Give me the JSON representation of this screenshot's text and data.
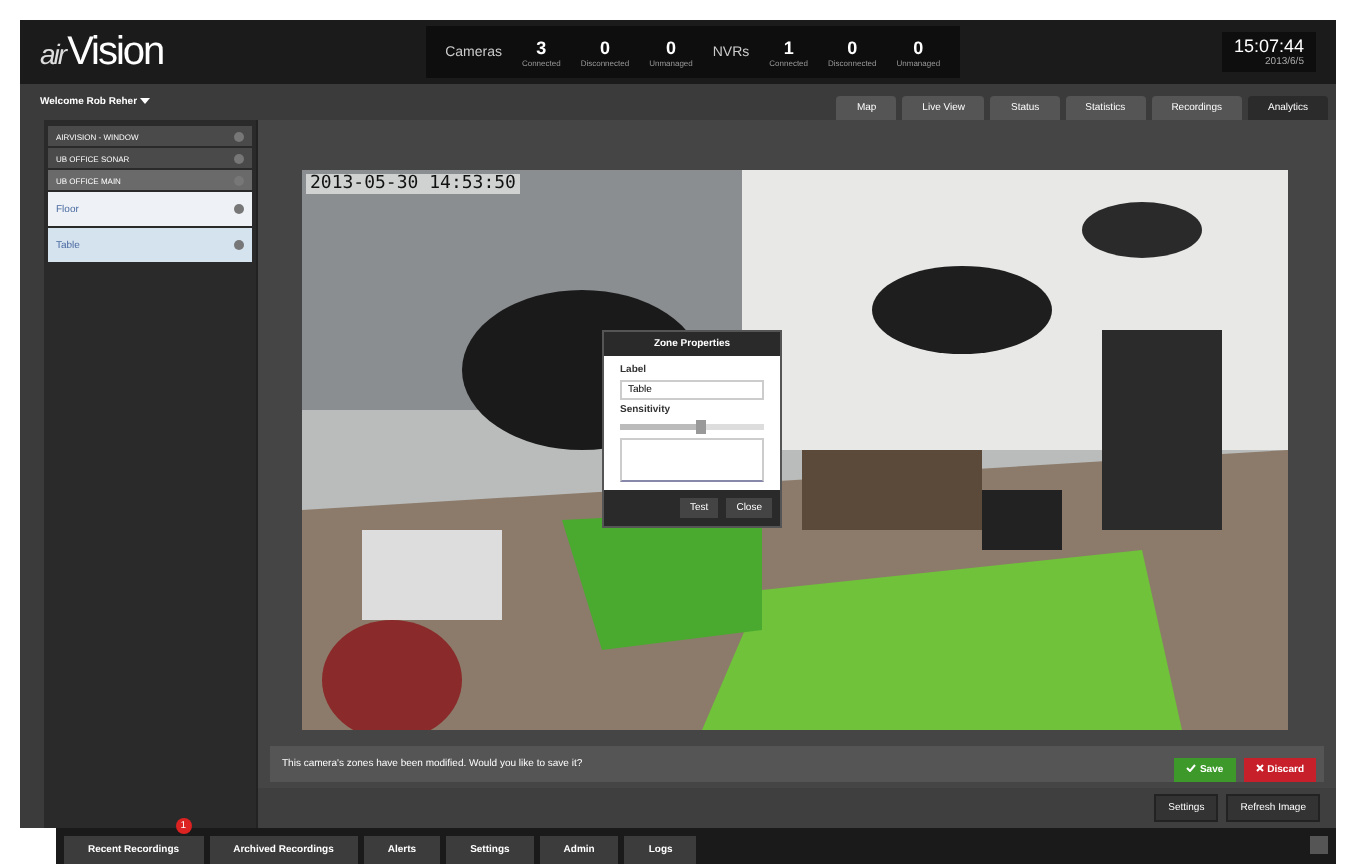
{
  "header": {
    "logo_prefix": "air",
    "logo_main": "Vision",
    "stats": [
      {
        "kind": "group",
        "label": "Cameras"
      },
      {
        "kind": "count",
        "value": "3",
        "caption": "Connected"
      },
      {
        "kind": "count",
        "value": "0",
        "caption": "Disconnected"
      },
      {
        "kind": "count",
        "value": "0",
        "caption": "Unmanaged"
      },
      {
        "kind": "group",
        "label": "NVRs"
      },
      {
        "kind": "count",
        "value": "1",
        "caption": "Connected"
      },
      {
        "kind": "count",
        "value": "0",
        "caption": "Disconnected"
      },
      {
        "kind": "count",
        "value": "0",
        "caption": "Unmanaged"
      }
    ],
    "time": "15:07:44",
    "date": "2013/6/5"
  },
  "user_menu": "Welcome Rob Reher",
  "tabs": [
    {
      "label": "Map",
      "selected": false
    },
    {
      "label": "Live View",
      "selected": false
    },
    {
      "label": "Status",
      "selected": false
    },
    {
      "label": "Statistics",
      "selected": false
    },
    {
      "label": "Recordings",
      "selected": false
    },
    {
      "label": "Analytics",
      "selected": true
    }
  ],
  "sidebar": {
    "cameras": [
      {
        "label": "AIRVISION - WINDOW",
        "selected": false
      },
      {
        "label": "UB OFFICE SONAR",
        "selected": false
      },
      {
        "label": "UB OFFICE MAIN",
        "selected": true
      }
    ],
    "zones": [
      {
        "label": "Floor",
        "selected": false
      },
      {
        "label": "Table",
        "selected": true
      }
    ]
  },
  "video": {
    "timestamp": "2013-05-30 14:53:50"
  },
  "dialog": {
    "title": "Zone Properties",
    "label_caption": "Label",
    "label_value": "Table",
    "sensitivity_caption": "Sensitivity",
    "sensitivity": {
      "level": 0.55
    },
    "buttons": [
      "Test",
      "Close"
    ]
  },
  "message": {
    "text": "This camera's zones have been modified. Would you like to save it?",
    "save": "Save",
    "discard": "Discard"
  },
  "toolbar": [
    "Settings",
    "Refresh Image"
  ],
  "bottom_tabs": [
    {
      "label": "Recent Recordings",
      "badge": "1"
    },
    {
      "label": "Archived Recordings"
    },
    {
      "label": "Alerts"
    },
    {
      "label": "Settings"
    },
    {
      "label": "Admin"
    },
    {
      "label": "Logs"
    }
  ]
}
